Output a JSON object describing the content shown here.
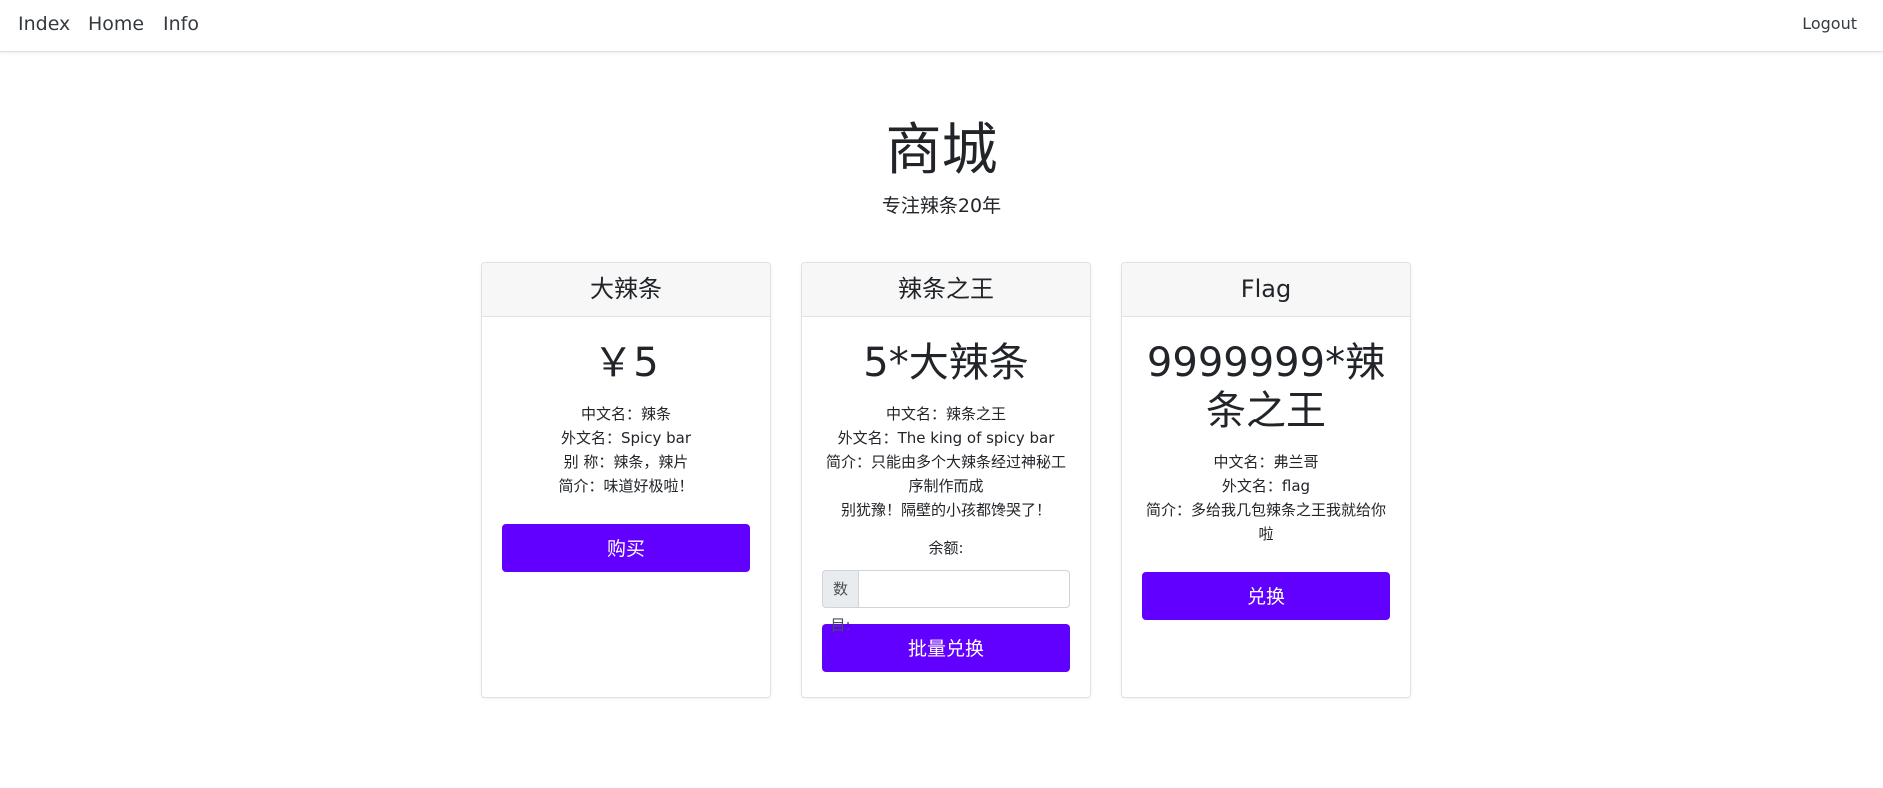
{
  "nav": {
    "links": [
      "Index",
      "Home",
      "Info"
    ],
    "logout": "Logout"
  },
  "hero": {
    "title": "商城",
    "subtitle": "专注辣条20年"
  },
  "cards": [
    {
      "header": "大辣条",
      "price": "￥5",
      "desc": [
        "中文名：辣条",
        "外文名：Spicy bar",
        "别 称：辣条，辣片",
        "简介：味道好极啦！"
      ],
      "button": "购买"
    },
    {
      "header": "辣条之王",
      "price": "5*大辣条",
      "desc": [
        "中文名：辣条之王",
        "外文名：The king of spicy bar",
        "简介：只能由多个大辣条经过神秘工序制作而成",
        "别犹豫！隔壁的小孩都馋哭了！"
      ],
      "balance_label": "余额:",
      "input_prefix": "数目:",
      "input_value": "",
      "button": "批量兑换"
    },
    {
      "header": "Flag",
      "price": "9999999*辣条之王",
      "desc": [
        "中文名：弗兰哥",
        "外文名：flag",
        "简介：多给我几包辣条之王我就给你啦"
      ],
      "button": "兑换"
    }
  ],
  "colors": {
    "accent": "#6200ff"
  }
}
